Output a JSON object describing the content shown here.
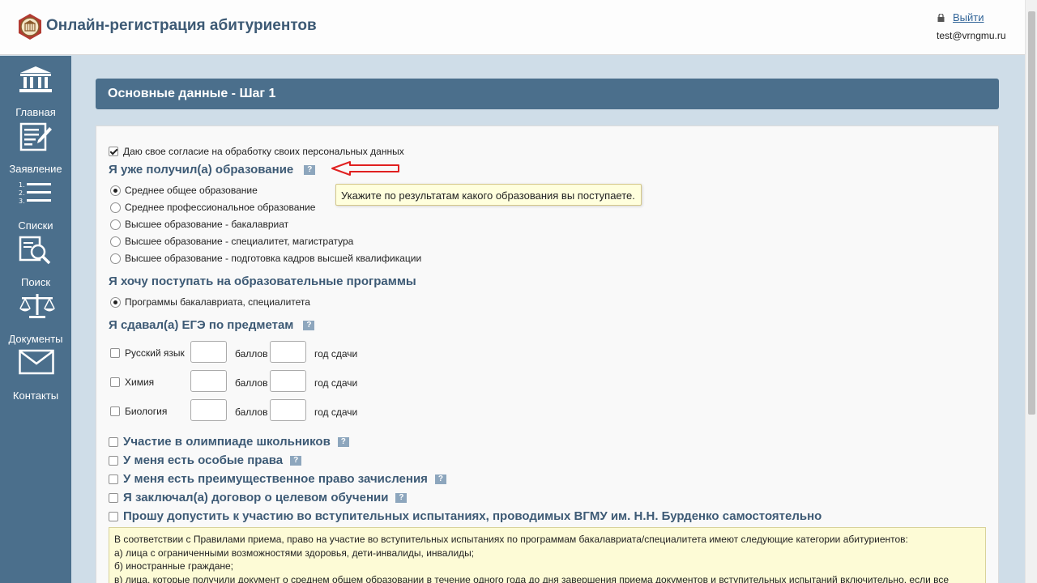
{
  "header": {
    "title": "Онлайн-регистрация абитуриентов",
    "logout_label": "Выйти",
    "user_email": "test@vrngmu.ru"
  },
  "sidebar": {
    "items": [
      {
        "label": "Главная",
        "icon": "bank-icon"
      },
      {
        "label": "Заявление",
        "icon": "document-edit-icon"
      },
      {
        "label": "Списки",
        "icon": "numbered-list-icon"
      },
      {
        "label": "Поиск",
        "icon": "document-search-icon"
      },
      {
        "label": "Документы",
        "icon": "scales-icon"
      },
      {
        "label": "Контакты",
        "icon": "envelope-icon"
      }
    ]
  },
  "section_title": "Основные данные - Шаг 1",
  "form": {
    "consent_label": "Даю свое согласие на обработку своих персональных данных",
    "education_heading": "Я уже получил(а) образование",
    "education_help": "?",
    "education_tooltip": "Укажите по результатам какого образования вы поступаете.",
    "education_options": [
      "Среднее общее образование",
      "Среднее профессиональное образование",
      "Высшее образование - бакалавриат",
      "Высшее образование - специалитет, магистратура",
      "Высшее образование - подготовка кадров высшей квалификации"
    ],
    "programs_heading": "Я хочу поступать на образовательные программы",
    "programs_option": "Программы бакалавриата, специалитета",
    "exam_heading": "Я сдавал(а) ЕГЭ по предметам",
    "exam_help": "?",
    "exam_subjects": [
      "Русский язык",
      "Химия",
      "Биология"
    ],
    "score_label": "баллов",
    "year_label": "год сдачи",
    "extra_options": [
      "Участие в олимпиаде школьников",
      "У меня есть особые права",
      "У меня есть преимущественное право зачисления",
      "Я заключал(а) договор о целевом обучении",
      "Прошу допустить к участию во вступительных испытаниях, проводимых ВГМУ им. Н.Н. Бурденко самостоятельно"
    ],
    "info_lines": [
      "В соответствии с Правилами приема, право на участие во вступительных испытаниях по программам бакалавриата/специалитета имеют следующие категории абитуриентов:",
      "а) лица с ограниченными возможностями здоровья, дети-инвалиды, инвалиды;",
      "б) иностранные граждане;",
      "в) лица, которые получили документ о среднем общем образовании в течение одного года до дня завершения приема документов и вступительных испытаний включительно, если все"
    ]
  },
  "colors": {
    "sidebar_bg": "#4b6f8c",
    "page_bg": "#cfdde8",
    "heading_text": "#3d5a75",
    "tooltip_bg": "#ffffdd",
    "info_bg": "#fdfbd6",
    "arrow": "#e02020"
  }
}
